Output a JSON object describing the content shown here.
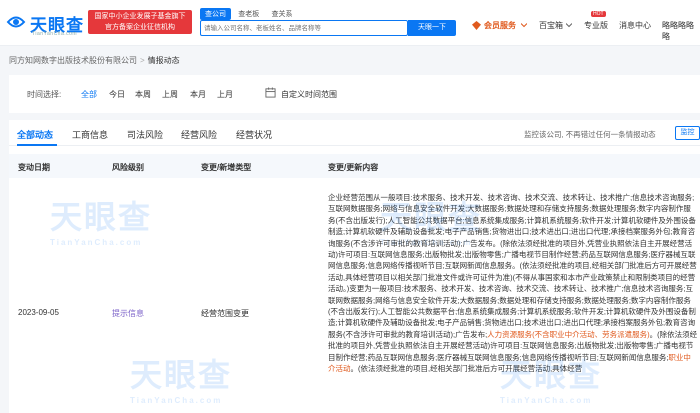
{
  "header": {
    "logo_text": "天眼查",
    "logo_sub": "TianYanCha.com",
    "promo_line1": "国家中小企业发展子基金旗下",
    "promo_line2": "官方备案企业征信机构",
    "search_tabs": [
      "查公司",
      "查老板",
      "查关系"
    ],
    "search_placeholder": "请输入公司名称、老板姓名、品牌名称等",
    "search_button": "天眼一下",
    "nav": {
      "member": "会员服务",
      "baibao": "百宝箱",
      "hot": "HOT",
      "pro": "专业版",
      "messages": "消息中心",
      "user": "略略略略略"
    }
  },
  "breadcrumb": {
    "company": "同方知网数字出版技术股份有限公司",
    "sep": ">",
    "current": "情报动态"
  },
  "filter": {
    "label": "时间选择:",
    "options": [
      "全部",
      "今日",
      "本周",
      "上周",
      "本月",
      "上月"
    ],
    "custom": "自定义时间范围"
  },
  "tabs": [
    "全部动态",
    "工商信息",
    "司法风险",
    "经营风险",
    "经营状况"
  ],
  "monitor": {
    "note": "监控该公司, 不再错过任何一条情报动态",
    "button": "监控"
  },
  "table": {
    "headers": [
      "变动日期",
      "风险级别",
      "变更/新增类型",
      "变更/更新内容"
    ],
    "row": {
      "date": "2023-09-05",
      "risk": "提示信息",
      "type": "经营范围变更",
      "content_a": "企业经营范围从一般项目:技术服务、技术开发、技术咨询、技术交流、技术转让、技术推广;信息技术咨询服务;互联网数据服务;网络与信息安全软件开发;大数据服务;数据处理和存储支持服务;数据处理服务;数字内容制作服务(不含出版发行);人工智能公共数据平台;信息系统集成服务;计算机系统服务;软件开发;计算机软硬件及外围设备制造;计算机软硬件及辅助设备批发;电子产品销售;货物进出口;技术进出口;进出口代理;承接档案服务外包;教育咨询服务(不含涉许可审批的教育培训活动);广告发布。(除依法须经批准的项目外,凭营业执照依法自主开展经营活动)许可项目:互联网信息服务;出版物批发;出版物零售;广播电视节目制作经营;药品互联网信息服务;医疗器械互联网信息服务;信息网络传播视听节目;互联网新闻信息服务。(依法须经批准的项目,经相关部门批准后方可开展经营活动,具体经营项目以相关部门批准文件或许可证件为准)(不得从事国家和本市产业政策禁止和限制类项目的经营活动。)变更为一般项目:技术服务、技术开发、技术咨询、技术交流、技术转让、技术推广;信息技术咨询服务;互联网数据服务;网络与信息安全软件开发;大数据服务;数据处理和存储支持服务;数据处理服务;数字内容制作服务(不含出版发行);人工智能公共数据平台;信息系统集成服务;计算机系统服务;软件开发;计算机软硬件及外围设备制造;计算机软硬件及辅助设备批发;电子产品销售;货物进出口;技术进出口;进出口代理;承接档案服务外包;教育咨询服务(不含涉许可审批的教育培训活动);广告发布;",
      "content_hl1": "人力资源服务(不含职业中介活动、劳务派遣服务)",
      "content_b": "。(除依法须经批准的项目外,凭营业执照依法自主开展经营活动)许可项目:互联网信息服务;出版物批发;出版物零售;广播电视节目制作经营;药品互联网信息服务;医疗器械互联网信息服务;信息网络传播视听节目;互联网新闻信息服务;",
      "content_hl2": "职业中介活动",
      "content_c": "。(依法须经批准的项目,经相关部门批准后方可开展经营活动,具体经营"
    }
  },
  "watermark": {
    "text": "天眼查",
    "sub": "TianYanCha.com"
  },
  "colors": {
    "brand": "#0a77f3",
    "promo_red": "#e5383b",
    "member_orange": "#e05a1e",
    "risk_purple": "#7b61c8"
  }
}
